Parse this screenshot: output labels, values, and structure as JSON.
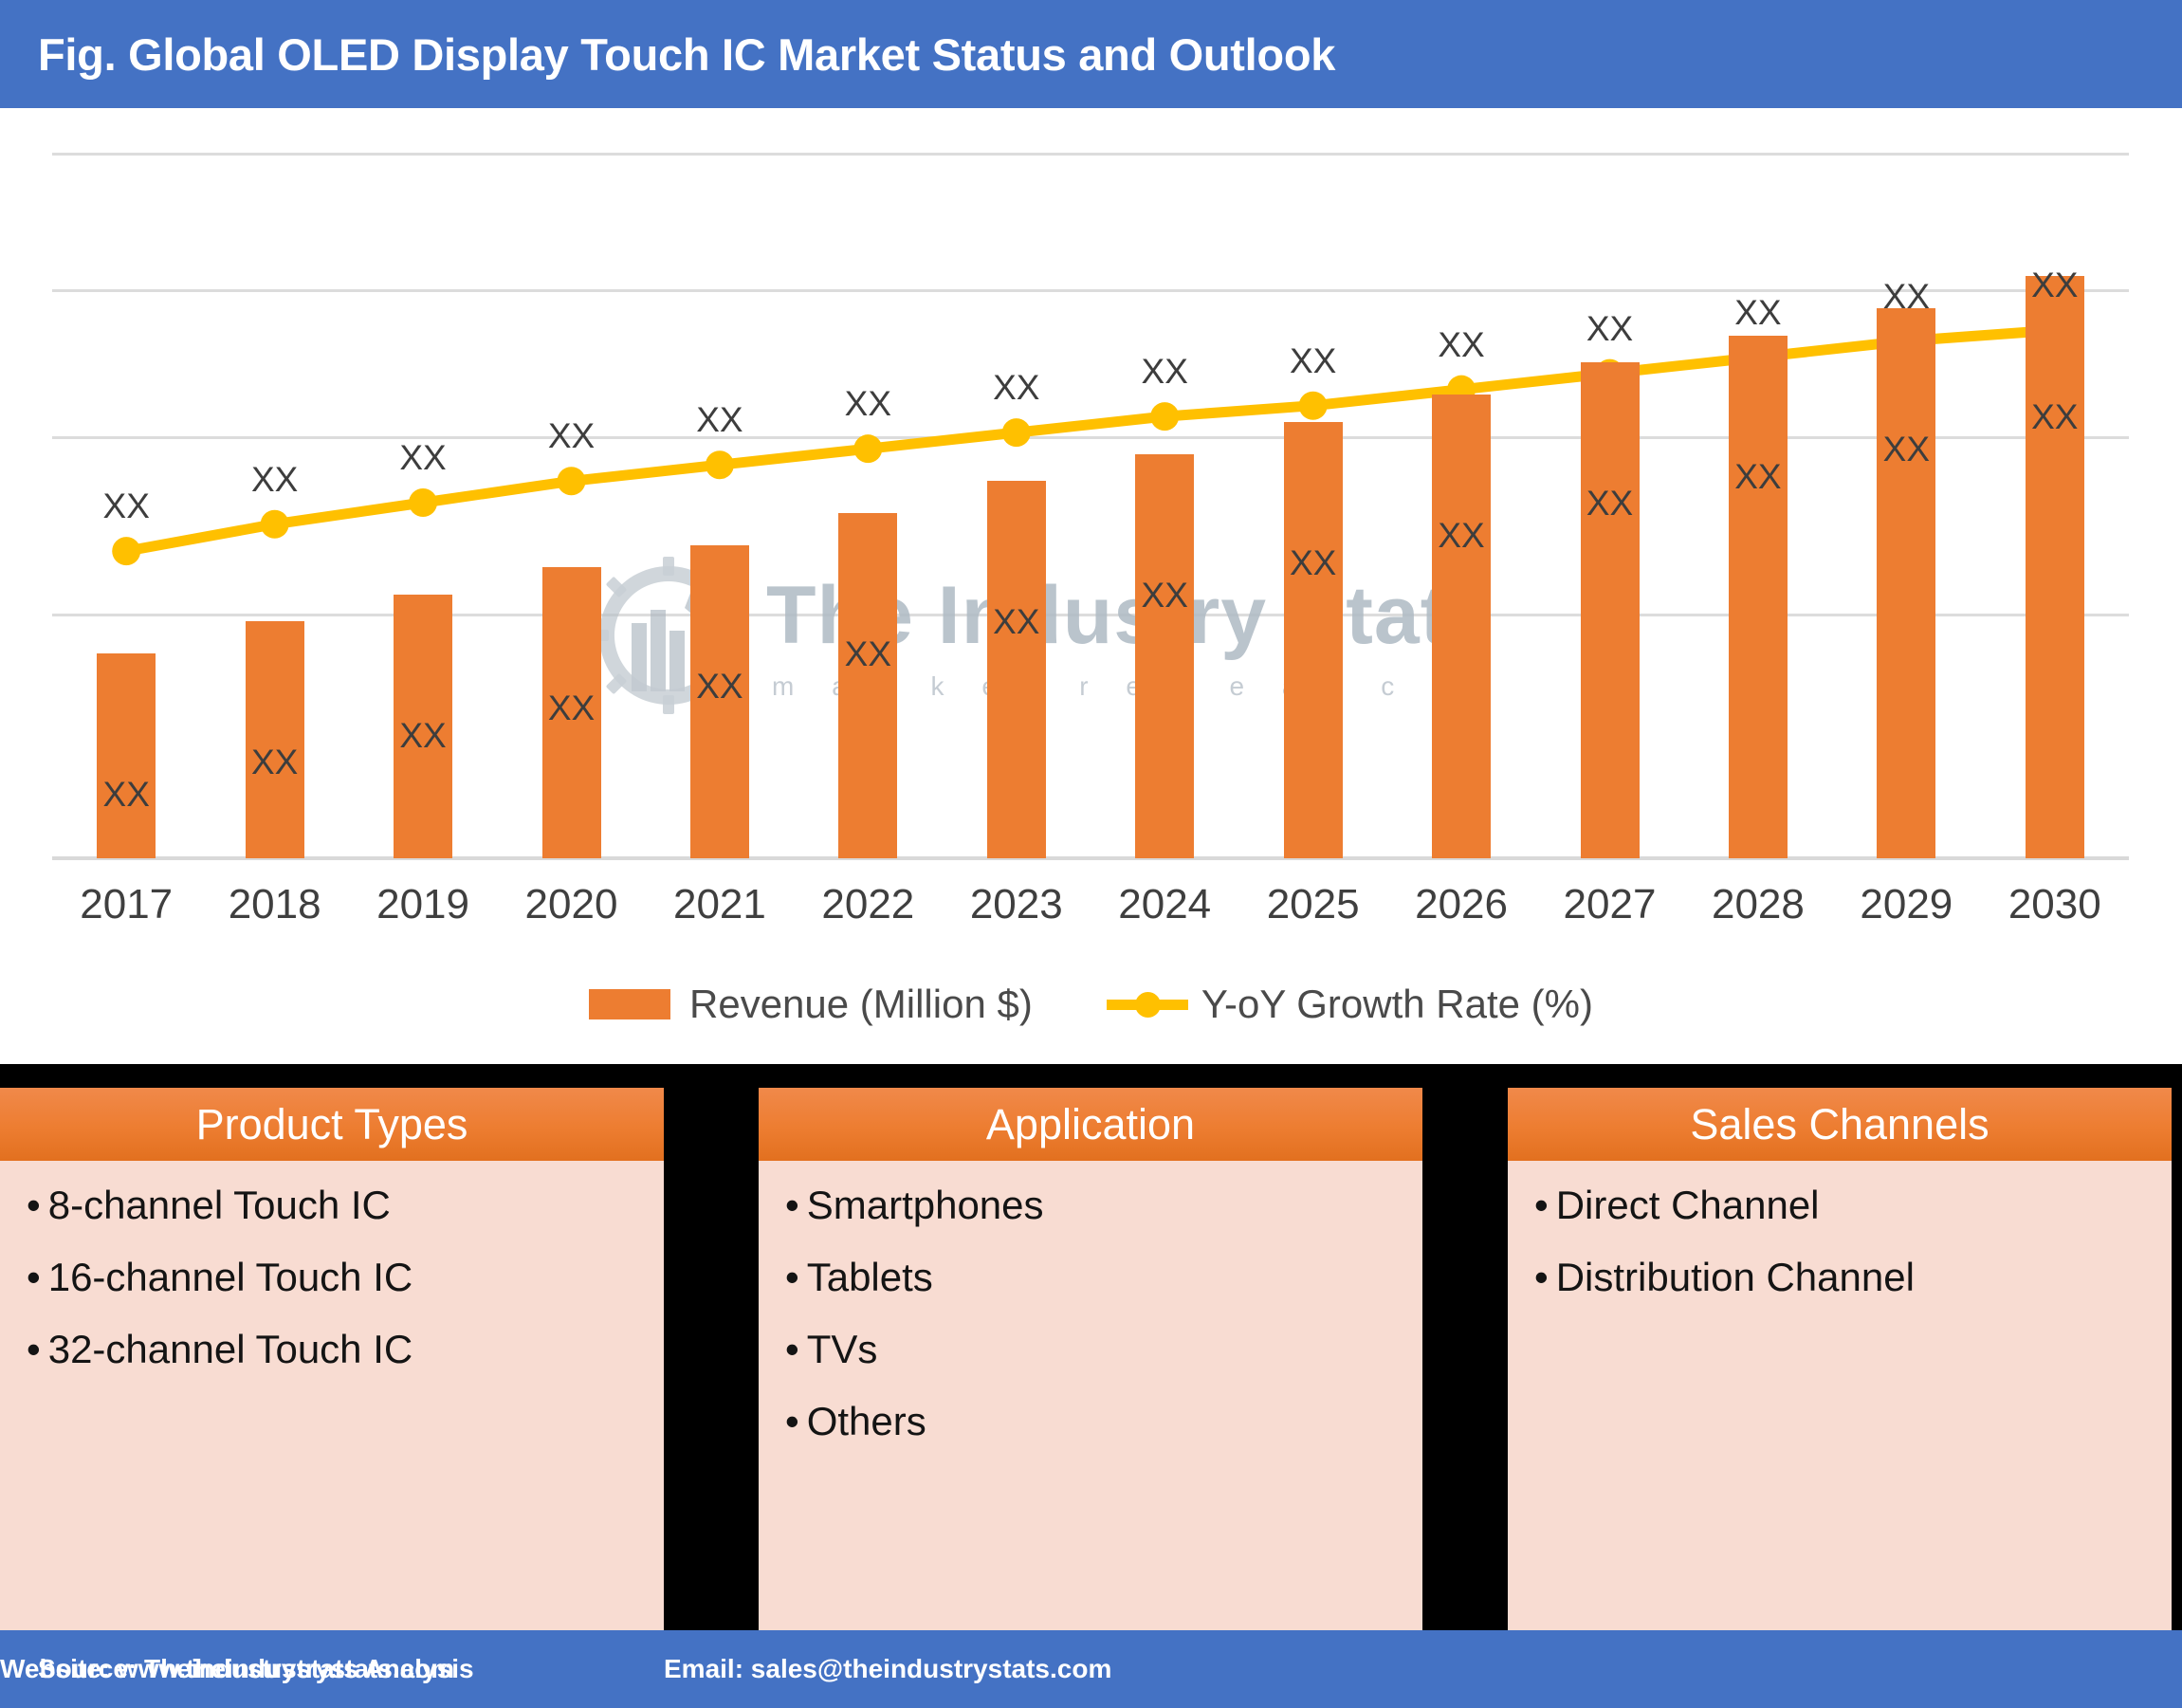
{
  "header": {
    "title": "Fig. Global OLED Display Touch IC Market Status and Outlook",
    "background_color": "#4472C4",
    "text_color": "#FFFFFF"
  },
  "watermark": {
    "title": "The Industry Stats",
    "subtitle": "m a r k e t    r e s e a r c h",
    "logo_icon": "gear-wrench-factory-icon"
  },
  "chart_data": {
    "type": "bar",
    "title": "Fig. Global OLED Display Touch IC Market Status and Outlook",
    "xlabel": "",
    "ylabel": "",
    "grid": true,
    "legend_position": "bottom",
    "axis_value_labels_hidden": true,
    "categories": [
      "2017",
      "2018",
      "2019",
      "2020",
      "2021",
      "2022",
      "2023",
      "2024",
      "2025",
      "2026",
      "2027",
      "2028",
      "2029",
      "2030"
    ],
    "series": [
      {
        "name": "Revenue (Million $)",
        "type": "bar",
        "color": "#ED7D31",
        "values": [
          38,
          44,
          49,
          54,
          58,
          64,
          70,
          75,
          81,
          86,
          92,
          97,
          102,
          108
        ],
        "point_labels": [
          "XX",
          "XX",
          "XX",
          "XX",
          "XX",
          "XX",
          "XX",
          "XX",
          "XX",
          "XX",
          "XX",
          "XX",
          "XX",
          "XX"
        ],
        "label_position": "inside"
      },
      {
        "name": "Y-oY Growth Rate (%)",
        "type": "line",
        "color": "#FFC000",
        "values": [
          57,
          62,
          66,
          70,
          73,
          76,
          79,
          82,
          84,
          87,
          90,
          93,
          96,
          98
        ],
        "point_labels": [
          "XX",
          "XX",
          "XX",
          "XX",
          "XX",
          "XX",
          "XX",
          "XX",
          "XX",
          "XX",
          "XX",
          "XX",
          "XX",
          "XX"
        ],
        "label_position": "above"
      }
    ],
    "ylim": [
      0,
      132
    ],
    "gridline_values": [
      26,
      52,
      78,
      104,
      130
    ]
  },
  "legend": {
    "items": [
      {
        "label": "Revenue (Million $)",
        "marker": "bar-swatch",
        "color": "#ED7D31"
      },
      {
        "label": "Y-oY Growth Rate (%)",
        "marker": "line-marker",
        "color": "#FFC000"
      }
    ]
  },
  "segments": [
    {
      "title": "Product Types",
      "items": [
        "8-channel Touch IC",
        "16-channel Touch IC",
        "32-channel Touch IC"
      ]
    },
    {
      "title": "Application",
      "items": [
        "Smartphones",
        "Tablets",
        "TVs",
        "Others"
      ]
    },
    {
      "title": "Sales Channels",
      "items": [
        "Direct Channel",
        "Distribution Channel"
      ]
    }
  ],
  "footer": {
    "source": "Source: Theindustrystats Analysis",
    "email": "Email: sales@theindustrystats.com",
    "website": "Website: www.theindustrystats.com",
    "background_color": "#4472C4"
  }
}
